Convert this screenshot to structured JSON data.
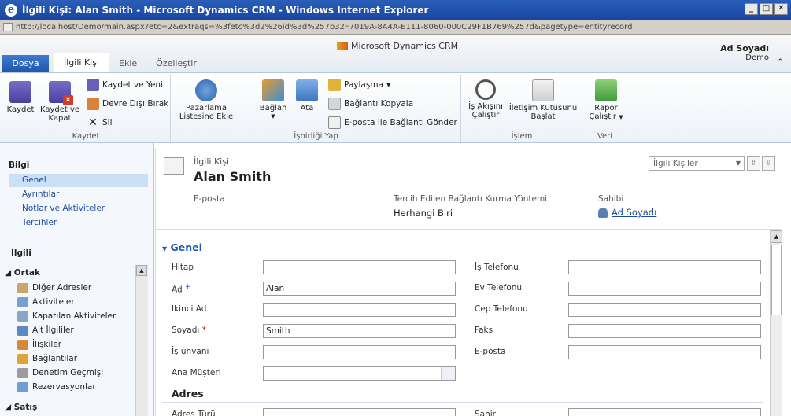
{
  "window": {
    "title": "İlgili Kişi: Alan Smith - Microsoft Dynamics CRM - Windows Internet Explorer",
    "address": "http://localhost/Demo/main.aspx?etc=2&extraqs=%3fetc%3d2%26id%3d%257b32F7019A-8A4A-E111-8060-000C29F1B769%257d&pagetype=entityrecord"
  },
  "header": {
    "product": "Microsoft Dynamics CRM",
    "user_name": "Ad Soyadı",
    "org_name": "Demo"
  },
  "ribbon_tabs": [
    "Dosya",
    "İlgili Kişi",
    "Ekle",
    "Özelleştir"
  ],
  "ribbon": {
    "save_group": {
      "label": "Kaydet",
      "save": "Kaydet",
      "save_close": "Kaydet ve Kapat",
      "save_new": "Kaydet ve Yeni",
      "deactivate": "Devre Dışı Bırak",
      "delete": "Sil"
    },
    "collab_group": {
      "label": "İşbirliği Yap",
      "add_marketing": "Pazarlama Listesine Ekle",
      "connect": "Bağlan",
      "assign": "Ata",
      "share": "Paylaşma",
      "copy_link": "Bağlantı Kopyala",
      "email_link": "E-posta ile Bağlantı Gönder"
    },
    "process_group": {
      "label": "İşlem",
      "start_workflow": "İş Akışını Çalıştır",
      "start_dialog": "İletişim Kutusunu Başlat"
    },
    "data_group": {
      "label": "Veri",
      "run_report": "Rapor Çalıştır"
    }
  },
  "nav": {
    "info_header": "Bilgi",
    "info_items": [
      "Genel",
      "Ayrıntılar",
      "Notlar ve Aktiviteler",
      "Tercihler"
    ],
    "related_header": "İlgili",
    "common_header": "Ortak",
    "common_items": [
      {
        "label": "Diğer Adresler",
        "icon": "address-icon"
      },
      {
        "label": "Aktiviteler",
        "icon": "activities-icon"
      },
      {
        "label": "Kapatılan Aktiviteler",
        "icon": "closed-activities-icon"
      },
      {
        "label": "Alt İlgililer",
        "icon": "sub-contacts-icon"
      },
      {
        "label": "İlişkiler",
        "icon": "relationships-icon"
      },
      {
        "label": "Bağlantılar",
        "icon": "connections-icon"
      },
      {
        "label": "Denetim Geçmişi",
        "icon": "audit-icon"
      },
      {
        "label": "Rezervasyonlar",
        "icon": "bookings-icon"
      }
    ],
    "sales_header": "Satış"
  },
  "record": {
    "type": "İlgili Kişi",
    "name": "Alan Smith",
    "view_selector": "İlgili Kişiler",
    "email_label": "E-posta",
    "pref_label": "Tercih Edilen Bağlantı Kurma Yöntemi",
    "pref_value": "Herhangi Biri",
    "owner_label": "Sahibi",
    "owner_value": "Ad Soyadı"
  },
  "form": {
    "section": "Genel",
    "subsection": "Adres",
    "left_fields": [
      {
        "label": "Hitap",
        "value": "",
        "mark": ""
      },
      {
        "label": "Ad",
        "value": "Alan",
        "mark": "+"
      },
      {
        "label": "İkinci Ad",
        "value": "",
        "mark": ""
      },
      {
        "label": "Soyadı",
        "value": "Smith",
        "mark": "*"
      },
      {
        "label": "İş unvanı",
        "value": "",
        "mark": ""
      },
      {
        "label": "Ana Müşteri",
        "value": "",
        "mark": ""
      }
    ],
    "right_fields": [
      {
        "label": "İş Telefonu",
        "value": ""
      },
      {
        "label": "Ev Telefonu",
        "value": ""
      },
      {
        "label": "Cep Telefonu",
        "value": ""
      },
      {
        "label": "Faks",
        "value": ""
      },
      {
        "label": "E-posta",
        "value": ""
      }
    ],
    "address_type_label": "Adres Türü",
    "ship_label": "Sahir"
  }
}
